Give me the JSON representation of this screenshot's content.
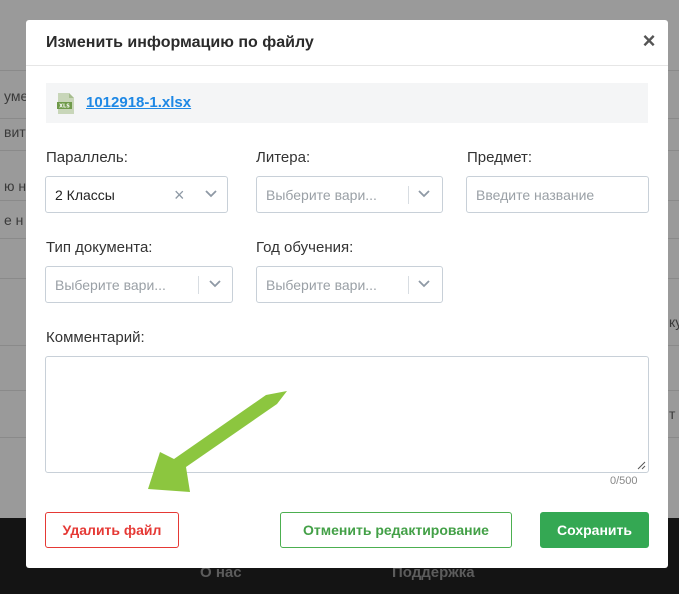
{
  "background": {
    "left_texts": [
      "уме",
      "вите",
      "ю н",
      "е н"
    ],
    "right_texts": [
      "ку",
      "т"
    ],
    "footer_links": [
      "О нас",
      "Поддержка"
    ]
  },
  "modal": {
    "title": "Изменить информацию по файлу",
    "close_label": "×",
    "file": {
      "name": "1012918-1.xlsx",
      "icon": "xls-file-icon",
      "icon_text": "XLS"
    },
    "fields": {
      "parallel": {
        "label": "Параллель:",
        "value": "2 Классы"
      },
      "litera": {
        "label": "Литера:",
        "placeholder": "Выберите вари..."
      },
      "subject": {
        "label": "Предмет:",
        "placeholder": "Введите название"
      },
      "doc_type": {
        "label": "Тип документа:",
        "placeholder": "Выберите вари..."
      },
      "study_year": {
        "label": "Год обучения:",
        "placeholder": "Выберите вари..."
      },
      "comment": {
        "label": "Комментарий:",
        "value": "",
        "counter": "0/500"
      }
    },
    "buttons": {
      "delete": "Удалить файл",
      "cancel": "Отменить редактирование",
      "save": "Сохранить"
    }
  },
  "colors": {
    "danger": "#e53935",
    "success": "#34a853",
    "link": "#1e88e5",
    "arrow": "#8cc63f"
  }
}
